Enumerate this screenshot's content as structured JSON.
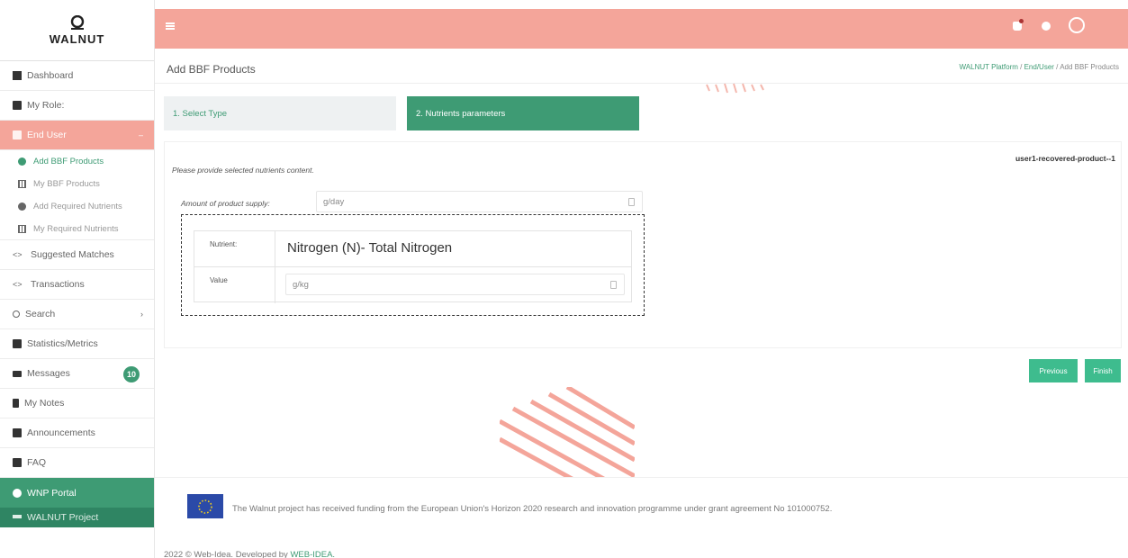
{
  "app": {
    "logo_text": "WALNUT"
  },
  "sidebar": {
    "items": [
      {
        "label": "Dashboard",
        "icon": "grid-icon"
      },
      {
        "label": "My Role:",
        "icon": "role-icon"
      },
      {
        "label": "End User",
        "icon": "user-group-icon"
      },
      {
        "label": "Suggested Matches",
        "icon": "code-icon"
      },
      {
        "label": "Transactions",
        "icon": "code-icon"
      },
      {
        "label": "Search",
        "icon": "search-icon"
      },
      {
        "label": "Statistics/Metrics",
        "icon": "chart-icon"
      },
      {
        "label": "Messages",
        "icon": "mail-icon",
        "badge": "10"
      },
      {
        "label": "My Notes",
        "icon": "bookmark-icon"
      },
      {
        "label": "Announcements",
        "icon": "announcement-icon"
      },
      {
        "label": "FAQ",
        "icon": "book-icon"
      },
      {
        "label": "WNP Portal",
        "icon": "globe-icon"
      },
      {
        "label": "WALNUT Project",
        "icon": "link-icon"
      }
    ],
    "sub_items": [
      {
        "label": "Add BBF Products"
      },
      {
        "label": "My BBF Products"
      },
      {
        "label": "Add Required Nutrients"
      },
      {
        "label": "My Required Nutrients"
      }
    ]
  },
  "header": {
    "title": "Add BBF Products",
    "breadcrumb": [
      "WALNUT Platform",
      "End/User",
      "Add BBF Products"
    ]
  },
  "steps": [
    {
      "label": "1. Select Type",
      "active": false
    },
    {
      "label": "2. Nutrients parameters",
      "active": true
    }
  ],
  "form": {
    "product_id": "user1-recovered-product--1",
    "instruction": "Please provide selected nutrients content.",
    "supply_label": "Amount of product supply:",
    "supply_placeholder": "g/day",
    "nutrient_label": "Nutrient:",
    "nutrient_name": "Nitrogen (N)- Total Nitrogen",
    "value_label": "Value",
    "value_placeholder": "g/kg"
  },
  "buttons": {
    "previous": "Previous",
    "finish": "Finish"
  },
  "footer": {
    "funding": "The Walnut project has received funding from the European Union's Horizon 2020 research and innovation programme under grant agreement No 101000752.",
    "copyright": "2022 © Web-Idea. Developed by",
    "developer": "WEB-IDEA."
  },
  "colors": {
    "accent": "#f4a59a",
    "green": "#3e9b74",
    "button_green": "#3ebc8e"
  }
}
